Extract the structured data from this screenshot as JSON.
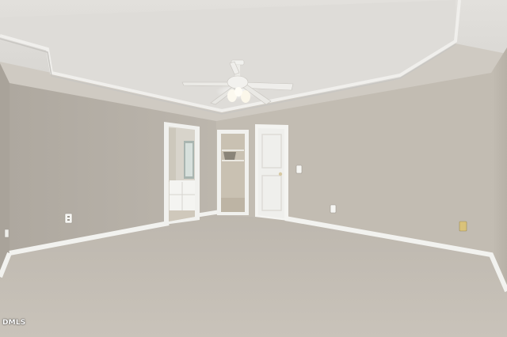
{
  "photo": {
    "watermark": "DMLS",
    "subject": "empty-bedroom"
  },
  "palette": {
    "ceiling": "#dcdad6",
    "ceiling_shadow": "#c9c7c3",
    "wall_left": "#b9b3aa",
    "wall_back": "#c4beb4",
    "wall_right": "#bdb7ad",
    "trim": "#f2f2ef",
    "carpet": "#c6c0b7",
    "carpet_far": "#bcb6ad",
    "door": "#f3f3f0",
    "fan_blade": "#eeeeeb",
    "fan_light": "#fbf8ee"
  },
  "icons": {
    "fan": "ceiling-fan-icon",
    "outlet": "outlet-icon",
    "switch": "light-switch-icon",
    "knob": "door-knob-icon"
  }
}
